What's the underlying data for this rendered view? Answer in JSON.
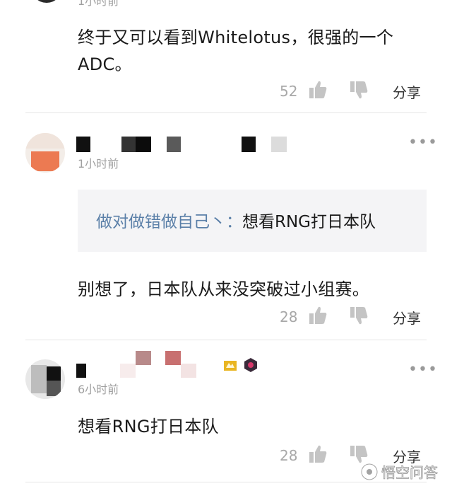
{
  "comments": [
    {
      "time": "1小时前",
      "text_line1": "终于又可以看到Whitelotus，很强的一个",
      "text_line2": "ADC。",
      "likes": "52",
      "share_label": "分享"
    },
    {
      "time": "1小时前",
      "quote_author": "做对做错做自己丶：",
      "quote_text": "想看RNG打日本队",
      "text": "别想了，日本队从来没突破过小组赛。",
      "likes": "28",
      "share_label": "分享"
    },
    {
      "time": "6小时前",
      "text": "想看RNG打日本队",
      "likes": "28",
      "share_label": "分享"
    }
  ],
  "more_label": "•••",
  "watermark": "悟空问答",
  "colors": {
    "link": "#5a7fa8",
    "quote_bg": "#f4f4f6",
    "muted": "#a0a0a0",
    "icon": "#c4c4c4"
  },
  "icons": [
    "thumbs-up-icon",
    "thumbs-down-icon",
    "more-icon",
    "badge-icon",
    "watermark-logo-icon"
  ]
}
